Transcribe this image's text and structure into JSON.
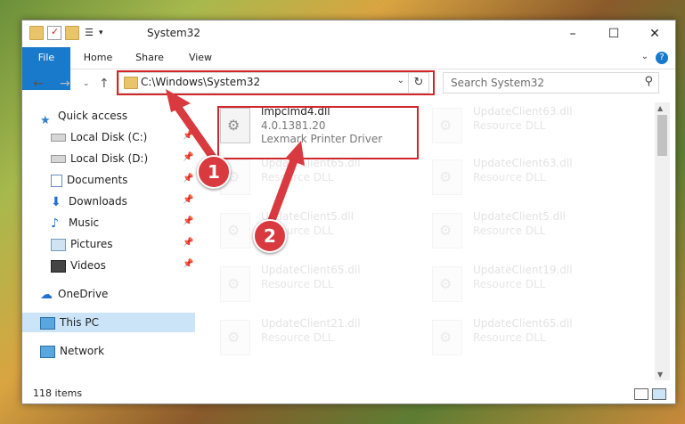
{
  "window": {
    "title": "System32",
    "controls": {
      "minimize": "–",
      "maximize": "☐",
      "close": "✕"
    }
  },
  "ribbon": {
    "tabs": [
      {
        "label": "File"
      },
      {
        "label": "Home"
      },
      {
        "label": "Share"
      },
      {
        "label": "View"
      }
    ],
    "help": "?"
  },
  "address": {
    "path": "C:\\Windows\\System32",
    "search_placeholder": "Search System32"
  },
  "nav": {
    "items": [
      {
        "label": "Quick access",
        "icon": "star-icon"
      },
      {
        "label": "Local Disk (C:)",
        "icon": "drive-icon",
        "pinned": true
      },
      {
        "label": "Local Disk (D:)",
        "icon": "drive-icon",
        "pinned": true
      },
      {
        "label": "Documents",
        "icon": "documents-icon",
        "pinned": true
      },
      {
        "label": "Downloads",
        "icon": "download-icon",
        "pinned": true
      },
      {
        "label": "Music",
        "icon": "music-icon",
        "pinned": true
      },
      {
        "label": "Pictures",
        "icon": "pictures-icon",
        "pinned": true
      },
      {
        "label": "Videos",
        "icon": "videos-icon",
        "pinned": true
      },
      {
        "label": "OneDrive",
        "icon": "cloud-icon"
      },
      {
        "label": "This PC",
        "icon": "computer-icon",
        "selected": true
      },
      {
        "label": "Network",
        "icon": "network-icon"
      }
    ]
  },
  "files": {
    "highlighted": {
      "name": "lmpclmd4.dll",
      "version": "4.0.1381.20",
      "description": "Lexmark Printer Driver"
    },
    "faded": [
      {
        "name": "UpdateClient63.dll",
        "type": "Resource DLL"
      },
      {
        "name": "UpdateClient65.dll",
        "type": "Resource DLL"
      },
      {
        "name": "UpdateClient63.dll",
        "type": "Resource DLL"
      },
      {
        "name": "UpdateClient5.dll",
        "type": "Resource DLL"
      },
      {
        "name": "UpdateClient5.dll",
        "type": "Resource DLL"
      },
      {
        "name": "UpdateClient65.dll",
        "type": "Resource DLL"
      },
      {
        "name": "UpdateClient19.dll",
        "type": "Resource DLL"
      },
      {
        "name": "UpdateClient21.dll",
        "type": "Resource DLL"
      },
      {
        "name": "UpdateClient65.dll",
        "type": "Resource DLL"
      }
    ]
  },
  "status": {
    "item_count": "118 items"
  },
  "callouts": [
    {
      "label": "1"
    },
    {
      "label": "2"
    }
  ],
  "colors": {
    "accent": "#1979ca",
    "highlight": "#d2262b",
    "selection": "#cce4f7"
  }
}
